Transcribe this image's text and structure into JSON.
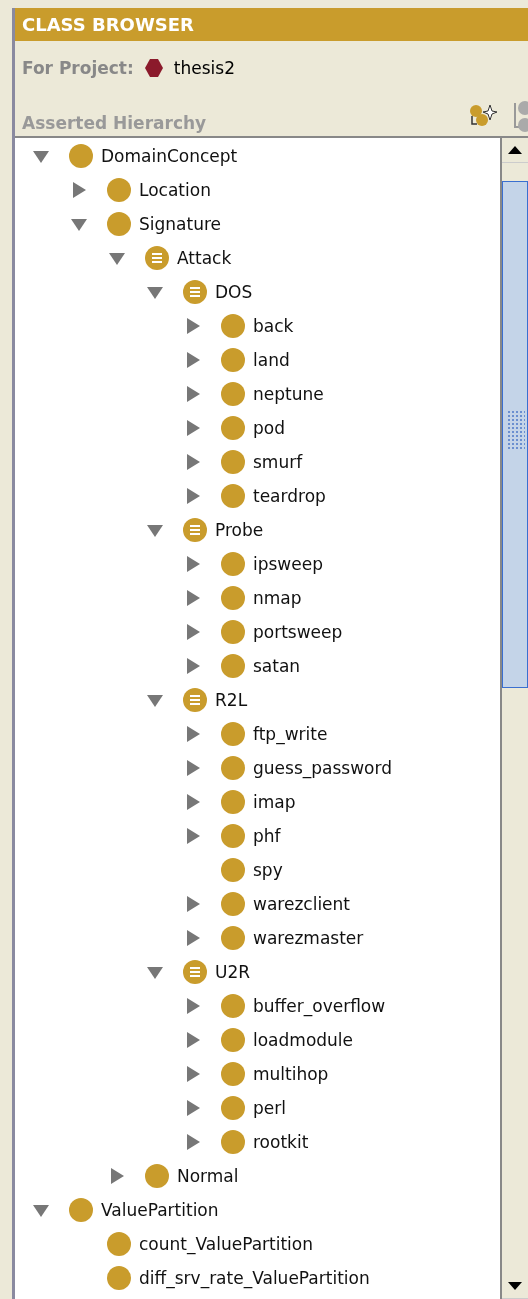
{
  "panel": {
    "title": "CLASS BROWSER",
    "project_label": "For Project:",
    "project_name": "thesis2",
    "hierarchy_label": "Asserted Hierarchy"
  },
  "tree": [
    {
      "label": "DomainConcept",
      "defined": false,
      "expanded": true,
      "children": [
        {
          "label": "Location",
          "defined": false,
          "expanded": false
        },
        {
          "label": "Signature",
          "defined": false,
          "expanded": true,
          "children": [
            {
              "label": "Attack",
              "defined": true,
              "expanded": true,
              "children": [
                {
                  "label": "DOS",
                  "defined": true,
                  "expanded": true,
                  "children": [
                    {
                      "label": "back",
                      "defined": false,
                      "expanded": false
                    },
                    {
                      "label": "land",
                      "defined": false,
                      "expanded": false
                    },
                    {
                      "label": "neptune",
                      "defined": false,
                      "expanded": false
                    },
                    {
                      "label": "pod",
                      "defined": false,
                      "expanded": false
                    },
                    {
                      "label": "smurf",
                      "defined": false,
                      "expanded": false
                    },
                    {
                      "label": "teardrop",
                      "defined": false,
                      "expanded": false
                    }
                  ]
                },
                {
                  "label": "Probe",
                  "defined": true,
                  "expanded": true,
                  "children": [
                    {
                      "label": "ipsweep",
                      "defined": false,
                      "expanded": false
                    },
                    {
                      "label": "nmap",
                      "defined": false,
                      "expanded": false
                    },
                    {
                      "label": "portsweep",
                      "defined": false,
                      "expanded": false
                    },
                    {
                      "label": "satan",
                      "defined": false,
                      "expanded": false
                    }
                  ]
                },
                {
                  "label": "R2L",
                  "defined": true,
                  "expanded": true,
                  "children": [
                    {
                      "label": "ftp_write",
                      "defined": false,
                      "expanded": false
                    },
                    {
                      "label": "guess_password",
                      "defined": false,
                      "expanded": false
                    },
                    {
                      "label": "imap",
                      "defined": false,
                      "expanded": false
                    },
                    {
                      "label": "phf",
                      "defined": false,
                      "expanded": false
                    },
                    {
                      "label": "spy",
                      "defined": false
                    },
                    {
                      "label": "warezclient",
                      "defined": false,
                      "expanded": false
                    },
                    {
                      "label": "warezmaster",
                      "defined": false,
                      "expanded": false
                    }
                  ]
                },
                {
                  "label": "U2R",
                  "defined": true,
                  "expanded": true,
                  "children": [
                    {
                      "label": "buffer_overflow",
                      "defined": false,
                      "expanded": false
                    },
                    {
                      "label": "loadmodule",
                      "defined": false,
                      "expanded": false
                    },
                    {
                      "label": "multihop",
                      "defined": false,
                      "expanded": false
                    },
                    {
                      "label": "perl",
                      "defined": false,
                      "expanded": false
                    },
                    {
                      "label": "rootkit",
                      "defined": false,
                      "expanded": false
                    }
                  ]
                }
              ]
            },
            {
              "label": "Normal",
              "defined": false,
              "expanded": false
            }
          ]
        }
      ]
    },
    {
      "label": "ValuePartition",
      "defined": false,
      "expanded": true,
      "children": [
        {
          "label": "count_ValuePartition",
          "defined": false
        },
        {
          "label": "diff_srv_rate_ValuePartition",
          "defined": false
        }
      ]
    }
  ]
}
